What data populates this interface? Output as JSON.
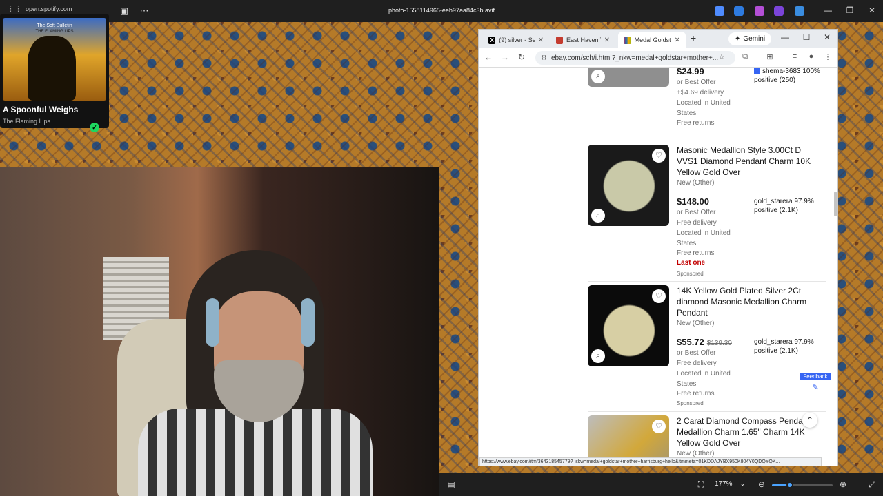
{
  "viewer": {
    "url_chip": "open.spotify.com",
    "file_title": "photo-1558114965-eeb97aa84c3b.avif",
    "zoom_level": "177%",
    "zoom_fraction": 0.3
  },
  "spotify": {
    "art_title": "The Soft Bulletin",
    "art_subtitle": "THE FLAMING LIPS",
    "track": "A Spoonful Weighs",
    "artist": "The Flaming Lips",
    "saved_icon": "check-icon"
  },
  "browser": {
    "tabs": [
      {
        "label": "(9) silver - Sea",
        "icon": "x-logo-icon"
      },
      {
        "label": "East Haven Tri",
        "icon": "east-haven-icon"
      },
      {
        "label": "Medal Goldsta",
        "icon": "ebay-icon"
      }
    ],
    "gemini_label": "Gemini",
    "address": "ebay.com/sch/i.html?_nkw=medal+goldstar+mother+...",
    "status_url": "https://www.ebay.com/itm/364318545779?_skw=medal+goldstar+mother+harrisburg+hello&itmmeta=01KDDAJYBX950K804Y0QDQYQK..."
  },
  "listings": [
    {
      "title": "",
      "condition": "",
      "price": "$24.99",
      "original_price": "",
      "offer": "or Best Offer",
      "shipping": "+$4.69 delivery",
      "location": "Located in United States",
      "returns": "Free returns",
      "last_one": "",
      "sponsored": "",
      "seller": "shema-3683 100% positive (250)"
    },
    {
      "title": "Masonic Medallion Style 3.00Ct D VVS1 Diamond Pendant Charm 10K Yellow Gold Over",
      "condition": "New (Other)",
      "price": "$148.00",
      "original_price": "",
      "offer": "or Best Offer",
      "shipping": "Free delivery",
      "location": "Located in United States",
      "returns": "Free returns",
      "last_one": "Last one",
      "sponsored": "Sponsored",
      "seller": "gold_starera 97.9% positive (2.1K)"
    },
    {
      "title": "14K Yellow Gold Plated Silver 2Ct diamond Masonic Medallion Charm Pendant",
      "condition": "New (Other)",
      "price": "$55.72",
      "original_price": "$139.30",
      "offer": "or Best Offer",
      "shipping": "Free delivery",
      "location": "Located in United States",
      "returns": "Free returns",
      "last_one": "",
      "sponsored": "Sponsored",
      "seller": "gold_starera 97.9% positive (2.1K)"
    },
    {
      "title": "2 Carat Diamond Compass Pendant Medallion Charm 1.65\" Charm 14K Yellow Gold Over",
      "condition": "New (Other)"
    }
  ],
  "feedback_label": "Feedback",
  "colors": {
    "ebay_blue": "#3665f3",
    "last_one_red": "#c20000",
    "spotify_green": "#1ed760"
  }
}
